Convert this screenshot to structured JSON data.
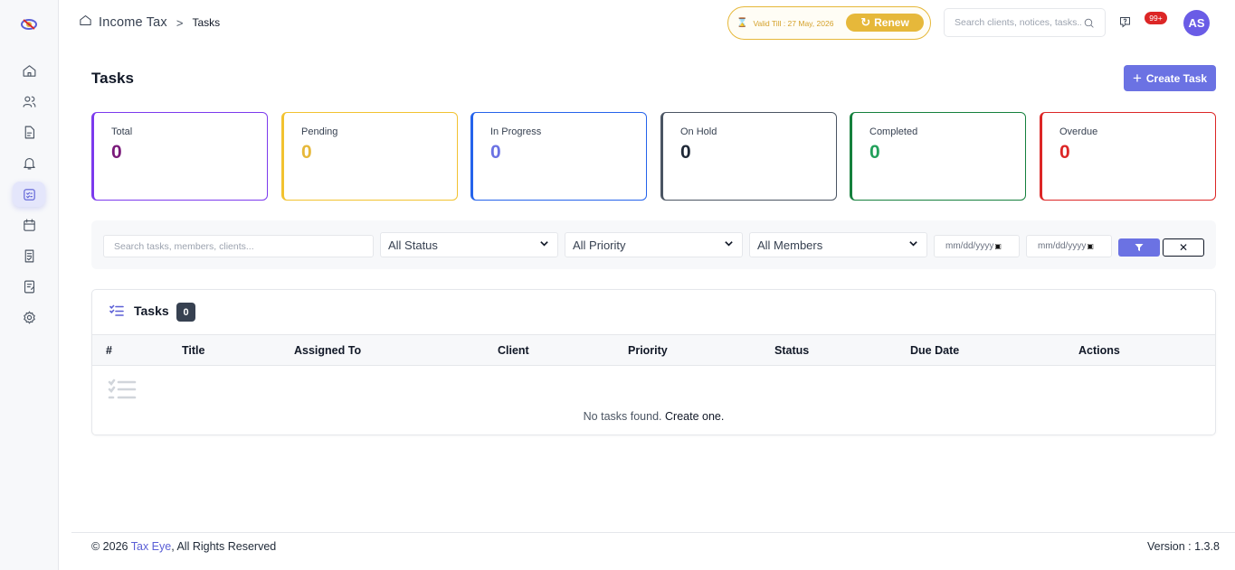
{
  "header": {
    "breadcrumb_root": "Income Tax",
    "breadcrumb_separator": ">",
    "breadcrumb_current": "Tasks",
    "validity_text": "Valid Till : 27 May, 2026",
    "renew_label": "Renew",
    "search_placeholder": "Search clients, notices, tasks...",
    "notification_count": "99+",
    "avatar_initials": "AS"
  },
  "page": {
    "title": "Tasks",
    "create_label": "Create Task"
  },
  "stats": [
    {
      "label": "Total",
      "value": "0",
      "color": "#7a1a7a",
      "border": "#7c3aed"
    },
    {
      "label": "Pending",
      "value": "0",
      "color": "#e6b83a",
      "border": "#f2c230"
    },
    {
      "label": "In Progress",
      "value": "0",
      "color": "#6b72e3",
      "border": "#2563eb"
    },
    {
      "label": "On Hold",
      "value": "0",
      "color": "#1f2937",
      "border": "#4b5563"
    },
    {
      "label": "Completed",
      "value": "0",
      "color": "#22a05a",
      "border": "#15803d"
    },
    {
      "label": "Overdue",
      "value": "0",
      "color": "#dc2626",
      "border": "#dc2626"
    }
  ],
  "filters": {
    "search_placeholder": "Search tasks, members, clients...",
    "status": "All Status",
    "priority": "All Priority",
    "members": "All Members",
    "date_from_placeholder": "mm/dd/yyyy",
    "date_to_placeholder": "mm/dd/yyyy",
    "clear_symbol": "✕"
  },
  "tasks_panel": {
    "title": "Tasks",
    "count": "0",
    "columns": [
      "#",
      "Title",
      "Assigned To",
      "Client",
      "Priority",
      "Status",
      "Due Date",
      "Actions"
    ],
    "empty_text": "No tasks found.",
    "empty_link": "Create one."
  },
  "footer": {
    "copyright_prefix": "© 2026",
    "brand": "Tax Eye",
    "rights": ", All Rights Reserved",
    "version": "Version : 1.3.8"
  },
  "colors": {
    "accent": "#6b72e3",
    "gold": "#e6b83a",
    "danger": "#dc2626"
  }
}
